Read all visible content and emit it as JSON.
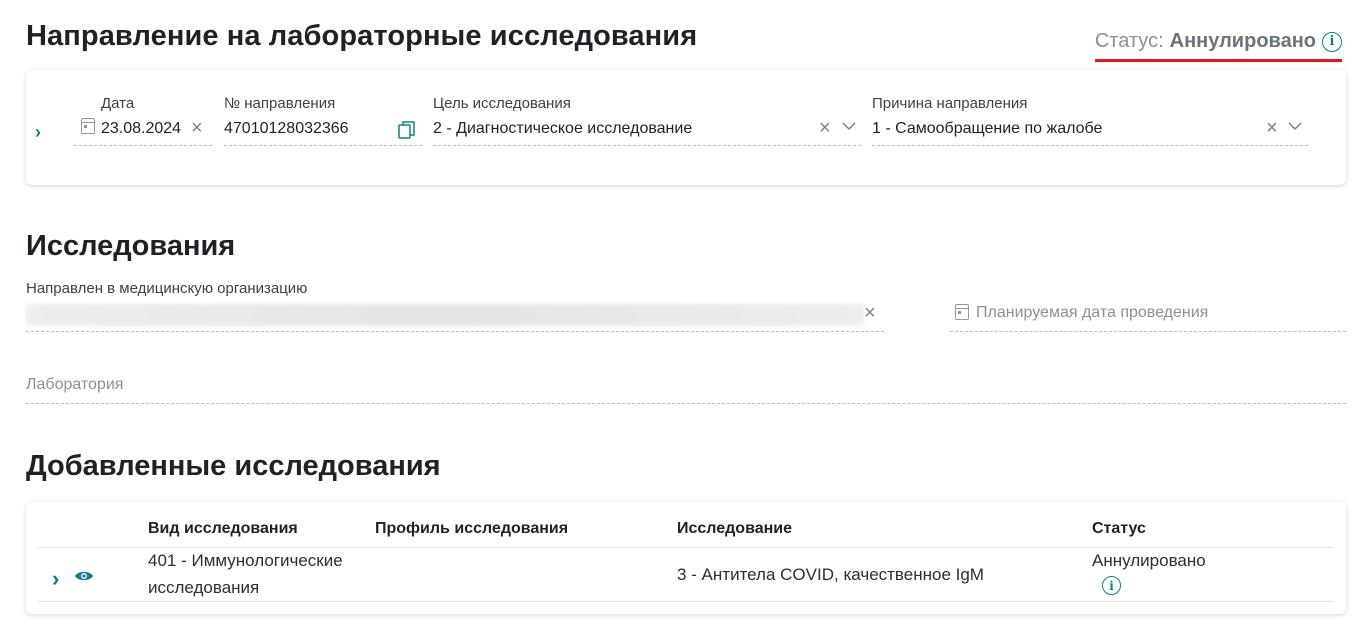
{
  "header": {
    "title": "Направление на лабораторные исследования",
    "status_label": "Статус:",
    "status_value": "Аннулировано"
  },
  "referral": {
    "date_label": "Дата",
    "date_value": "23.08.2024",
    "number_label": "№ направления",
    "number_value": "47010128032366",
    "purpose_label": "Цель исследования",
    "purpose_value": "2 - Диагностическое исследование",
    "reason_label": "Причина направления",
    "reason_value": "1 - Самообращение по жалобе"
  },
  "research": {
    "title": "Исследования",
    "org_label": "Направлен в медицинскую организацию",
    "planned_date_placeholder": "Планируемая дата проведения",
    "lab_placeholder": "Лаборатория"
  },
  "added": {
    "title": "Добавленные исследования",
    "columns": [
      "Вид исследования",
      "Профиль исследования",
      "Исследование",
      "Статус"
    ],
    "rows": [
      {
        "type_line1": "401 - Иммунологические",
        "type_line2": "исследования",
        "profile": "",
        "study": "3 - Антитела COVID, качественное IgM",
        "status": "Аннулировано"
      }
    ]
  },
  "colors": {
    "accent": "#137e85",
    "status_underline": "#e0161c"
  },
  "icons": [
    "info-icon",
    "calendar-icon",
    "clear-icon",
    "copy-icon",
    "chevron-down-icon",
    "chevron-right-icon",
    "eye-icon"
  ]
}
